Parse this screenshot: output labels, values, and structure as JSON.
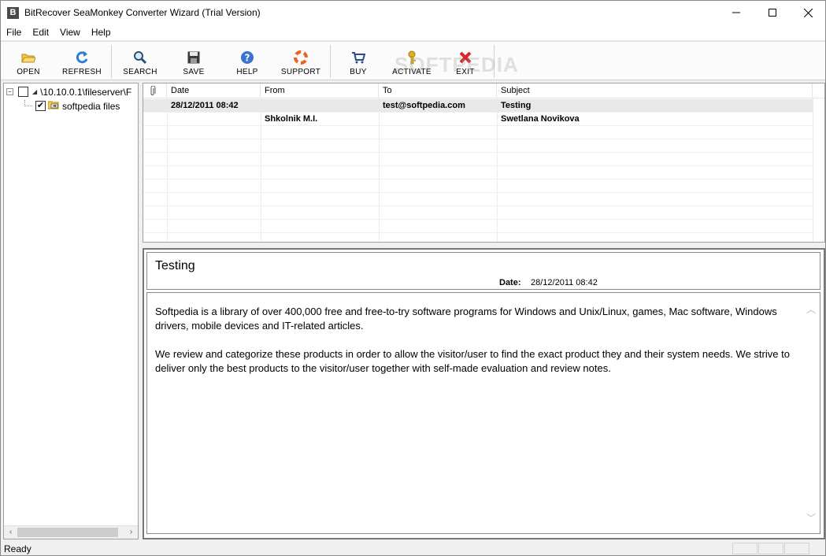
{
  "window": {
    "title": "BitRecover SeaMonkey Converter Wizard (Trial Version)",
    "app_icon_letter": "B"
  },
  "menu": [
    "File",
    "Edit",
    "View",
    "Help"
  ],
  "toolbar": {
    "open": "OPEN",
    "refresh": "REFRESH",
    "search": "SEARCH",
    "save": "SAVE",
    "help": "HELP",
    "support": "SUPPORT",
    "buy": "BUY",
    "activate": "ACTIVATE",
    "exit": "EXIT"
  },
  "watermark": "SOFTPEDIA",
  "tree": {
    "root_label": "\\10.10.0.1\\fileserver\\F",
    "child_label": "softpedia files"
  },
  "list": {
    "columns": [
      "Date",
      "From",
      "To",
      "Subject"
    ],
    "rows": [
      {
        "date": "28/12/2011 08:42",
        "from": "",
        "to": "test@softpedia.com",
        "subject": "Testing"
      },
      {
        "date": "",
        "from": "Shkolnik M.I.",
        "to": "",
        "subject": "Swetlana Novikova"
      }
    ]
  },
  "preview": {
    "subject": "Testing",
    "date_label": "Date:",
    "date_value": "28/12/2011 08:42",
    "body": [
      "Softpedia is a library of over 400,000 free and free-to-try software programs for Windows and Unix/Linux, games, Mac software, Windows drivers, mobile devices and IT-related articles.",
      "We review and categorize these products in order to allow the visitor/user to find the exact product they and their system needs. We strive to deliver only the best products to the visitor/user together with self-made evaluation and review notes."
    ]
  },
  "status": {
    "text": "Ready"
  },
  "colors": {
    "refresh_blue": "#2a7fd4",
    "help_blue": "#3b73d1",
    "exit_red": "#d8272a",
    "activate_gold": "#e0b020"
  }
}
